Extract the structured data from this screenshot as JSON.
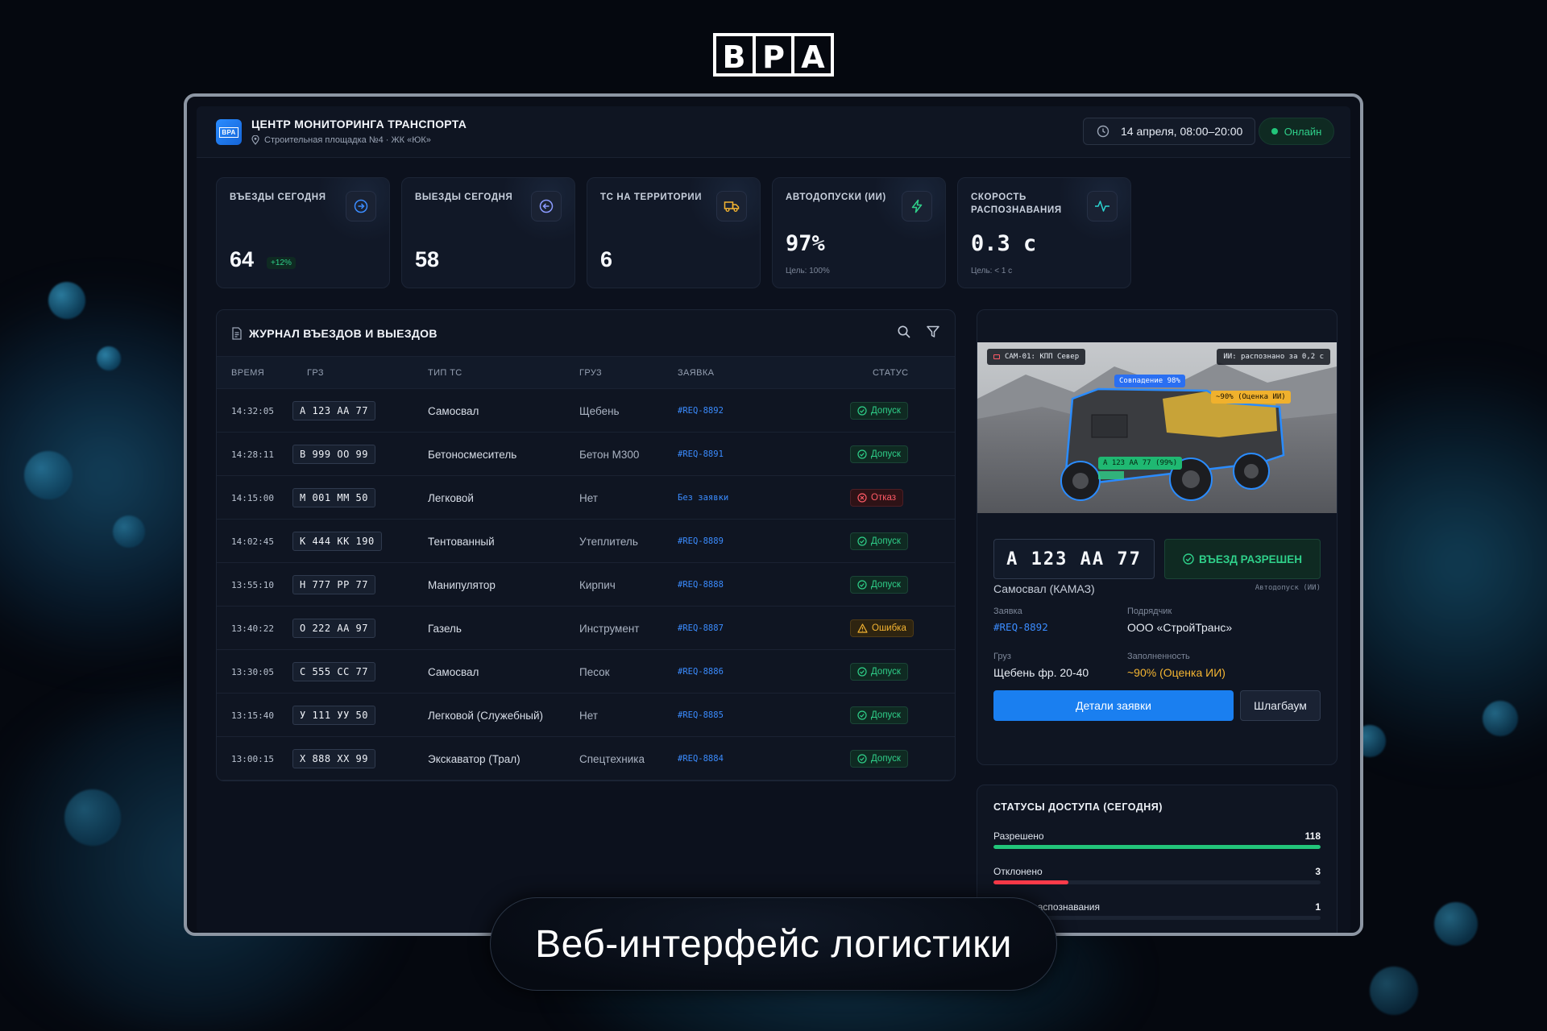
{
  "brand": {
    "logo_text": "BPA"
  },
  "caption": "Веб-интерфейс логистики",
  "header": {
    "app_logo_text": "BPA",
    "title": "ЦЕНТР МОНИТОРИНГА ТРАНСПОРТА",
    "subtitle": "Строительная площадка №4 · ЖК «ЮК»",
    "date": "14 апреля, 08:00–20:00",
    "online": "Онлайн"
  },
  "kpis": [
    {
      "label": "ВЪЕЗДЫ СЕГОДНЯ",
      "value": "64",
      "badge": "+12%",
      "icon": "arrow-right-circle-icon",
      "color": "#3b8cff"
    },
    {
      "label": "ВЫЕЗДЫ СЕГОДНЯ",
      "value": "58",
      "icon": "arrow-left-circle-icon",
      "color": "#8b9bff"
    },
    {
      "label": "ТС НА ТЕРРИТОРИИ",
      "value": "6",
      "icon": "truck-icon",
      "color": "#f5b532"
    },
    {
      "label": "АВТОДОПУСКИ (ИИ)",
      "value": "97%",
      "hint": "Цель: 100%",
      "icon": "lightning-icon",
      "color": "#2fd08a"
    },
    {
      "label": "СКОРОСТЬ РАСПОЗНАВАНИЯ",
      "value": "0.3 с",
      "hint": "Цель: < 1 с",
      "icon": "pulse-icon",
      "color": "#2ad4d0"
    }
  ],
  "journal": {
    "title": "ЖУРНАЛ ВЪЕЗДОВ И ВЫЕЗДОВ",
    "columns": [
      "ВРЕМЯ",
      "ГРЗ",
      "ТИП ТС",
      "ГРУЗ",
      "ЗАЯВКА",
      "СТАТУС"
    ],
    "rows": [
      {
        "time": "14:32:05",
        "plate": "А 123 АА 77",
        "type": "Самосвал",
        "cargo": "Щебень",
        "req": "#REQ-8892",
        "status": "Допуск",
        "kind": "ok"
      },
      {
        "time": "14:28:11",
        "plate": "В 999 ОО 99",
        "type": "Бетоносмеситель",
        "cargo": "Бетон М300",
        "req": "#REQ-8891",
        "status": "Допуск",
        "kind": "ok"
      },
      {
        "time": "14:15:00",
        "plate": "М 001 ММ 50",
        "type": "Легковой",
        "cargo": "Нет",
        "req": "Без заявки",
        "status": "Отказ",
        "kind": "deny"
      },
      {
        "time": "14:02:45",
        "plate": "К 444 КК 190",
        "type": "Тентованный",
        "cargo": "Утеплитель",
        "req": "#REQ-8889",
        "status": "Допуск",
        "kind": "ok"
      },
      {
        "time": "13:55:10",
        "plate": "Н 777 РР 77",
        "type": "Манипулятор",
        "cargo": "Кирпич",
        "req": "#REQ-8888",
        "status": "Допуск",
        "kind": "ok"
      },
      {
        "time": "13:40:22",
        "plate": "О 222 АА 97",
        "type": "Газель",
        "cargo": "Инструмент",
        "req": "#REQ-8887",
        "status": "Ошибка",
        "kind": "err"
      },
      {
        "time": "13:30:05",
        "plate": "С 555 СС 77",
        "type": "Самосвал",
        "cargo": "Песок",
        "req": "#REQ-8886",
        "status": "Допуск",
        "kind": "ok"
      },
      {
        "time": "13:15:40",
        "plate": "У 111 УУ 50",
        "type": "Легковой (Служебный)",
        "cargo": "Нет",
        "req": "#REQ-8885",
        "status": "Допуск",
        "kind": "ok"
      },
      {
        "time": "13:00:15",
        "plate": "Х 888 ХХ 99",
        "type": "Экскаватор (Трал)",
        "cargo": "Спецтехника",
        "req": "#REQ-8884",
        "status": "Допуск",
        "kind": "ok"
      }
    ]
  },
  "camera": {
    "cam_label": "CAM-01: КПП Север",
    "ai_label": "ИИ: распознано за 0,2 с",
    "match_label": "Совпадение 98%",
    "fill_label": "~90% (Оценка ИИ)",
    "plate_label": "А 123 АА 77 (99%)"
  },
  "detail": {
    "plate": "А 123 АА 77",
    "access": "ВЪЕЗД РАЗРЕШЕН",
    "vehicle": "Самосвал (КАМАЗ)",
    "auto_note": "Автодопуск (ИИ)",
    "req_label": "Заявка",
    "req_value": "#REQ-8892",
    "contractor_label": "Подрядчик",
    "contractor_value": "ООО «СтройТранс»",
    "cargo_label": "Груз",
    "cargo_value": "Щебень фр. 20-40",
    "fill_label": "Заполненность",
    "fill_value": "~90% (Оценка ИИ)",
    "btn_details": "Детали заявки",
    "btn_barrier": "Шлагбаум"
  },
  "access_stats": {
    "title": "СТАТУСЫ ДОСТУПА (СЕГОДНЯ)",
    "items": [
      {
        "label": "Разрешено",
        "value": "118",
        "fraction": 1.0,
        "color": "#22c57a"
      },
      {
        "label": "Отклонено",
        "value": "3",
        "fraction": 0.23,
        "color": "#ff3b4a"
      },
      {
        "label": "Ошибка распознавания",
        "value": "1",
        "fraction": 0.08,
        "color": "#f5b532"
      }
    ]
  }
}
